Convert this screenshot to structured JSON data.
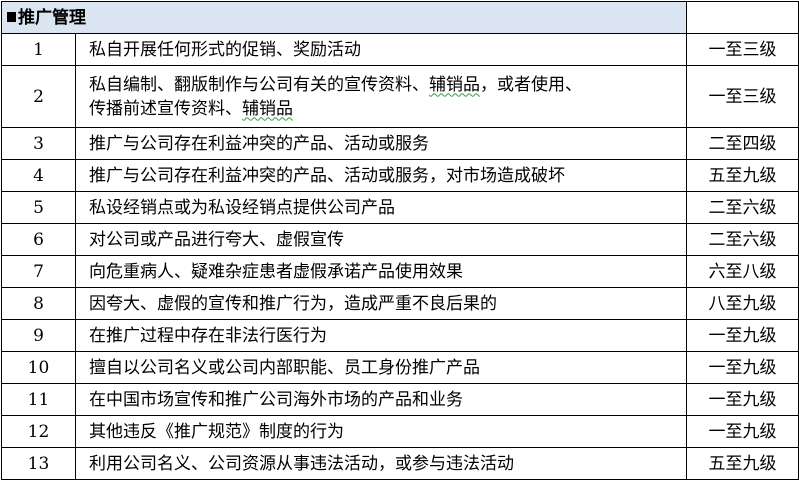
{
  "section": {
    "icon": "black-square-icon",
    "title": "推广管理"
  },
  "rows": [
    {
      "num": "1",
      "desc": [
        "私自开展任何形式的促销、奖励活动"
      ],
      "level": "一至三级"
    },
    {
      "num": "2",
      "desc": [
        "私自编制、翻版制作与公司有关的宣传资料、",
        "辅销品",
        "，或者使用、",
        "传播前述宣传资料、",
        "辅销品"
      ],
      "level": "一至三级"
    },
    {
      "num": "3",
      "desc": [
        "推广与公司存在利益冲突的产品、活动或服务"
      ],
      "level": "二至四级"
    },
    {
      "num": "4",
      "desc": [
        "推广与公司存在利益冲突的产品、活动或服务，对市场造成破坏"
      ],
      "level": "五至九级"
    },
    {
      "num": "5",
      "desc": [
        "私设经销点或为私设经销点提供公司产品"
      ],
      "level": "二至六级"
    },
    {
      "num": "6",
      "desc": [
        "对公司或产品进行夸大、虚假宣传"
      ],
      "level": "二至六级"
    },
    {
      "num": "7",
      "desc": [
        "向危重病人、疑难杂症患者虚假承诺产品使用效果"
      ],
      "level": "六至八级"
    },
    {
      "num": "8",
      "desc": [
        "因夸大、虚假的宣传和推广行为，造成严重不良后果的"
      ],
      "level": "八至九级"
    },
    {
      "num": "9",
      "desc": [
        "在推广过程中存在非法行医行为"
      ],
      "level": "一至九级"
    },
    {
      "num": "10",
      "desc": [
        "擅自以公司名义或公司内部职能、员工身份推广产品"
      ],
      "level": "一至九级"
    },
    {
      "num": "11",
      "desc": [
        "在中国市场宣传和推广公司海外市场的产品和业务"
      ],
      "level": "一至九级"
    },
    {
      "num": "12",
      "desc": [
        "其他违反《推广规范》制度的行为"
      ],
      "level": "一至九级"
    },
    {
      "num": "13",
      "desc": [
        "利用公司名义、公司资源从事违法活动，或参与违法活动"
      ],
      "level": "五至九级"
    }
  ]
}
